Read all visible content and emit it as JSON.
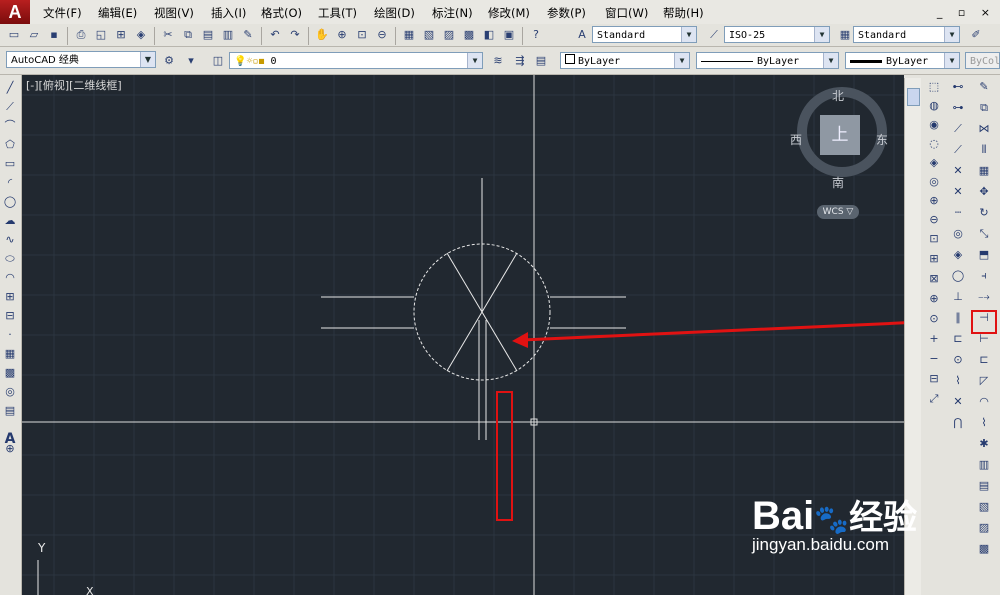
{
  "menu": {
    "items": [
      "文件(F)",
      "编辑(E)",
      "视图(V)",
      "插入(I)",
      "格式(O)",
      "工具(T)",
      "绘图(D)",
      "标注(N)",
      "修改(M)",
      "参数(P)",
      "窗口(W)",
      "帮助(H)"
    ],
    "app_logo": "A",
    "window_controls": "_ ▫ ×"
  },
  "toolbar_styles": {
    "text_style": "Standard",
    "dim_style": "ISO-25",
    "table_style": "Standard"
  },
  "toolbar_props": {
    "workspace": "AutoCAD 经典",
    "layer": "0",
    "color": "ByLayer",
    "linetype": "ByLayer",
    "lineweight": "ByLayer",
    "plot_style": "ByColo"
  },
  "viewport": {
    "label": "[-][俯视][二维线框]",
    "viewcube": {
      "north": "北",
      "south": "南",
      "east": "东",
      "west": "西",
      "face": "上",
      "wcs": "WCS ▽"
    },
    "ucs": {
      "y": "Y",
      "x": "X"
    }
  },
  "left_tools": [
    "line-icon",
    "construction-line-icon",
    "polyline-icon",
    "polygon-icon",
    "rectangle-icon",
    "arc-icon",
    "circle-icon",
    "revision-cloud-icon",
    "spline-icon",
    "ellipse-icon",
    "ellipse-arc-icon",
    "insert-block-icon",
    "make-block-icon",
    "point-icon",
    "hatch-icon",
    "gradient-icon",
    "region-icon",
    "table-icon",
    "multiline-text-icon",
    "add-selected-icon"
  ],
  "left_text_tool": "A",
  "watermark": {
    "brand": "Bai",
    "brand2": "经验",
    "url": "jingyan.baidu.com"
  },
  "colors": {
    "canvas": "#212830",
    "highlight": "#e01212",
    "grid": "#2c3540",
    "geometry": "#e8e8e8"
  }
}
